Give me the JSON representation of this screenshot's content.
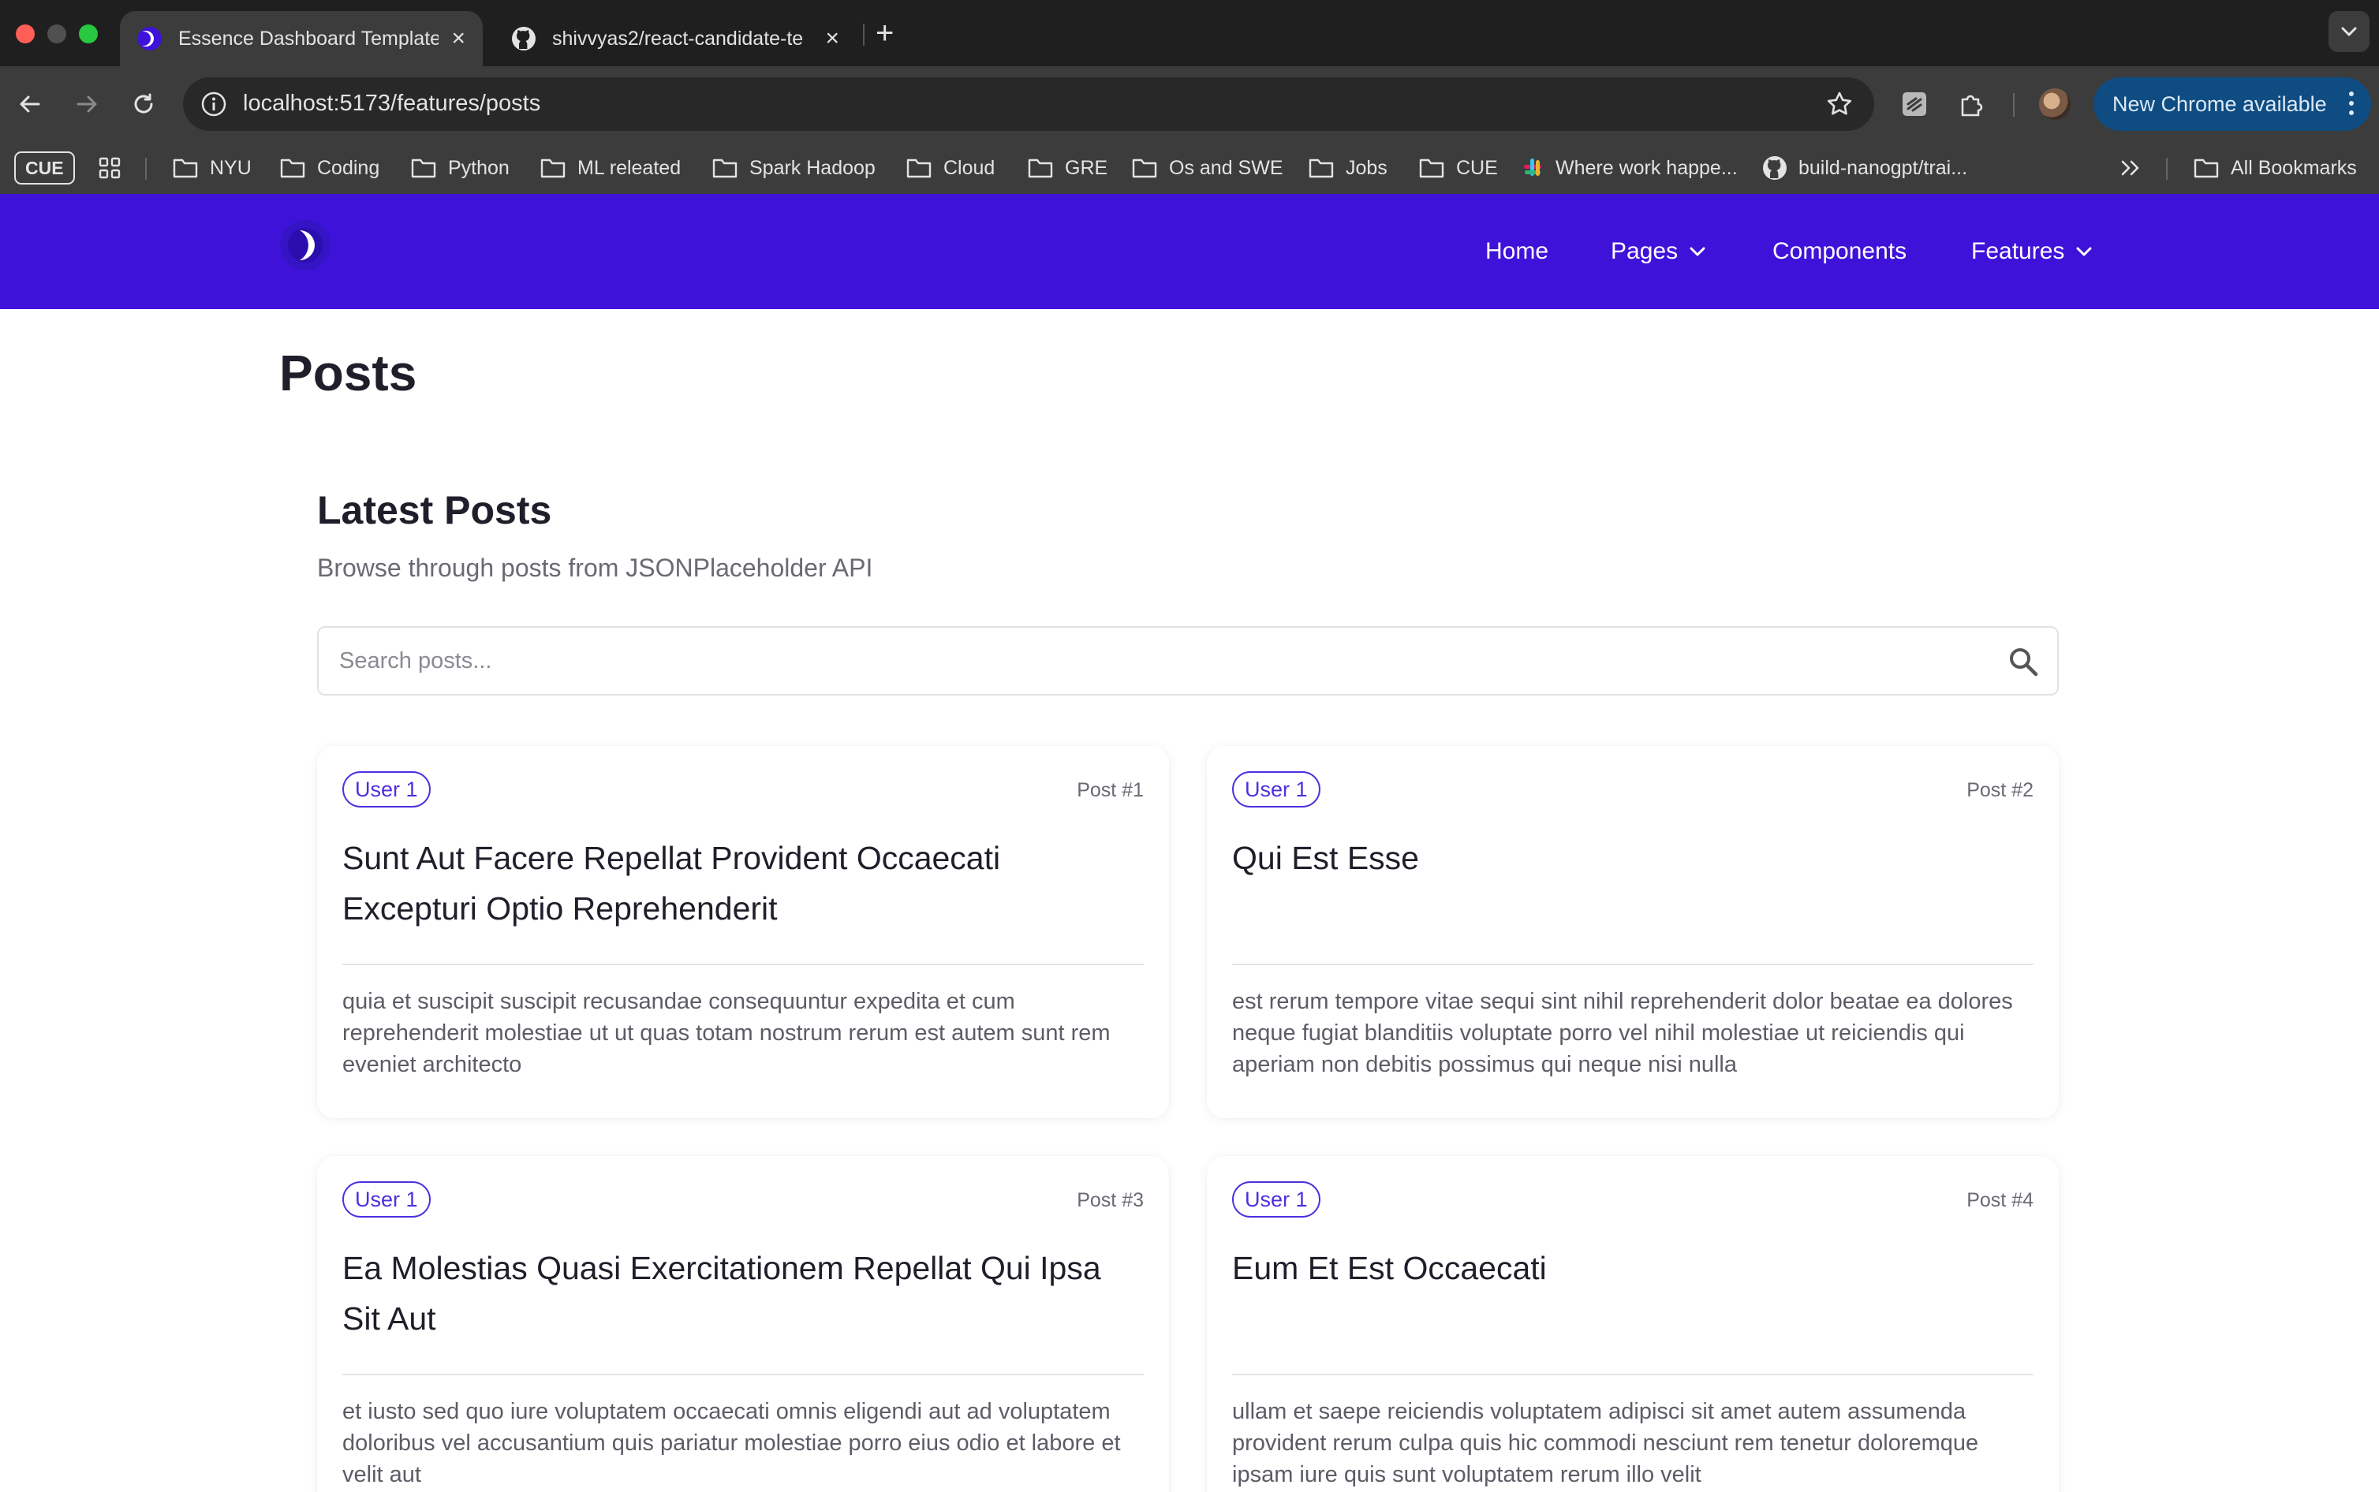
{
  "browser": {
    "tabs": [
      {
        "title": "Essence Dashboard Template",
        "active": true
      },
      {
        "title": "shivvyas2/react-candidate-te",
        "active": false
      }
    ],
    "url": "localhost:5173/features/posts",
    "update_label": "New Chrome available",
    "bookmarks": {
      "cue_box": "CUE",
      "items": [
        "NYU",
        "Coding",
        "Python",
        "ML releated",
        "Spark Hadoop",
        "Cloud",
        "GRE",
        "Os and SWE",
        "Jobs",
        "CUE",
        "Where work happe...",
        "build-nanogpt/trai..."
      ],
      "all_bookmarks": "All Bookmarks"
    }
  },
  "site": {
    "brand_color": "#3f12d9",
    "nav": [
      "Home",
      "Pages",
      "Components",
      "Features"
    ]
  },
  "page": {
    "title": "Posts",
    "section_title": "Latest Posts",
    "section_subtitle": "Browse through posts from JSONPlaceholder API",
    "search_placeholder": "Search posts..."
  },
  "posts": [
    {
      "user": "User 1",
      "number": "Post #1",
      "title": "Sunt Aut Facere Repellat Provident Occaecati Excepturi Optio Reprehenderit",
      "body": "quia et suscipit suscipit recusandae consequuntur expedita et cum reprehenderit molestiae ut ut quas totam nostrum rerum est autem sunt rem eveniet architecto"
    },
    {
      "user": "User 1",
      "number": "Post #2",
      "title": "Qui Est Esse",
      "body": "est rerum tempore vitae sequi sint nihil reprehenderit dolor beatae ea dolores neque fugiat blanditiis voluptate porro vel nihil molestiae ut reiciendis qui aperiam non debitis possimus qui neque nisi nulla"
    },
    {
      "user": "User 1",
      "number": "Post #3",
      "title": "Ea Molestias Quasi Exercitationem Repellat Qui Ipsa Sit Aut",
      "body": "et iusto sed quo iure voluptatem occaecati omnis eligendi aut ad voluptatem doloribus vel accusantium quis pariatur molestiae porro eius odio et labore et velit aut"
    },
    {
      "user": "User 1",
      "number": "Post #4",
      "title": "Eum Et Est Occaecati",
      "body": "ullam et saepe reiciendis voluptatem adipisci sit amet autem assumenda provident rerum culpa quis hic commodi nesciunt rem tenetur doloremque ipsam iure quis sunt voluptatem rerum illo velit"
    }
  ]
}
